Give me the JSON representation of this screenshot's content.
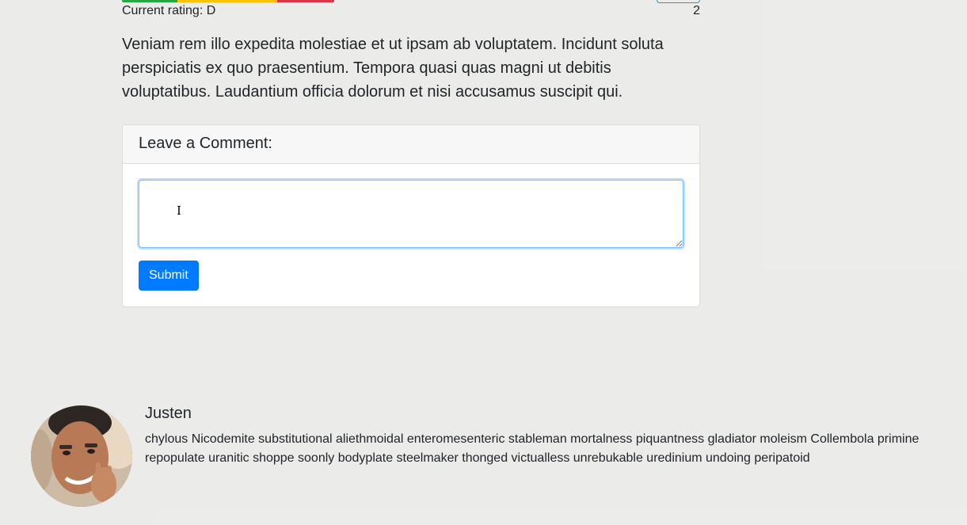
{
  "rating": {
    "label": "Current rating: D",
    "count": "2",
    "bar_segments": [
      {
        "color": "#28a745",
        "fraction": 0.26
      },
      {
        "color": "#ffc107",
        "fraction": 0.47
      },
      {
        "color": "#dc3545",
        "fraction": 0.27
      }
    ],
    "tab_color": "#17a2b8"
  },
  "article": {
    "body": "Veniam rem illo expedita molestiae et ut ipsam ab voluptatem. Incidunt soluta perspiciatis ex quo praesentium. Tempora quasi quas magni ut debitis voluptatibus. Laudantium officia dolorum et nisi accusamus suscipit qui."
  },
  "comment_form": {
    "header": "Leave a Comment:",
    "textarea_value": "",
    "submit_label": "Submit",
    "accent_color": "#007bff"
  },
  "comments": [
    {
      "author": "Justen",
      "text": "chylous Nicodemite substitutional aliethmoidal enteromesenteric stableman mortalness piquantness gladiator moleism Collembola primine repopulate uranitic shoppe soonly bodyplate steelmaker thonged victualless unrebukable uredinium undoing peripatoid",
      "avatar_icon": "user-photo"
    }
  ]
}
